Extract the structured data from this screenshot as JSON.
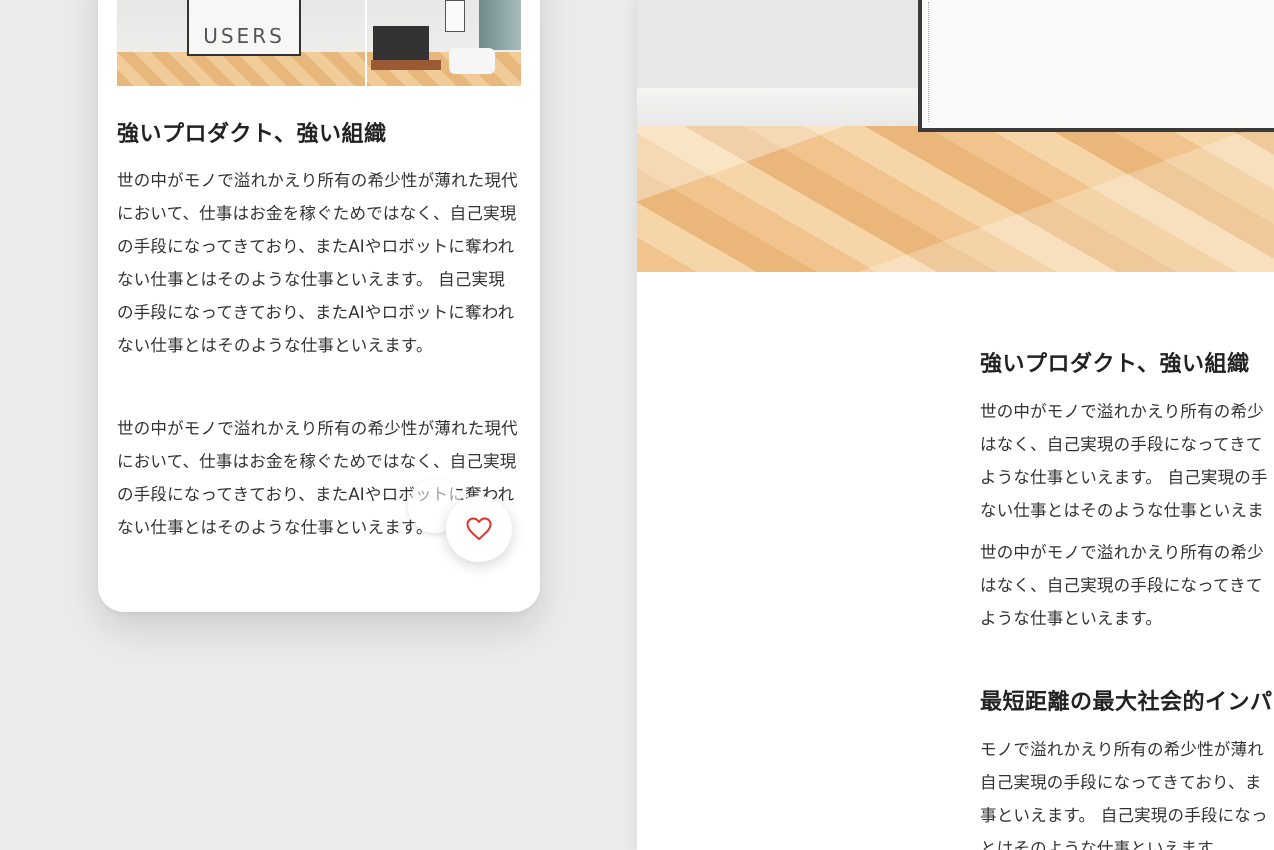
{
  "mobile_card": {
    "photo_poster_text": "USERS",
    "title": "強いプロダクト、強い組織",
    "paragraphs": [
      "世の中がモノで溢れかえり所有の希少性が薄れた現代において、仕事はお金を稼ぐためではなく、自己実現の手段になってきており、またAIやロボットに奪われない仕事とはそのような仕事といえます。 自己実現の手段になってきており、またAIやロボットに奪われない仕事とはそのような仕事といえます。",
      "世の中がモノで溢れかえり所有の希少性が薄れた現代において、仕事はお金を稼ぐためではなく、自己実現の手段になってきており、またAIやロボットに奪われない仕事とはそのような仕事といえます。"
    ],
    "favorite_icon": "heart-icon",
    "favorite_color": "#e0312b"
  },
  "desktop_panel": {
    "section1": {
      "title": "強いプロダクト、強い組織",
      "para1_lines": [
        "世の中がモノで溢れかえり所有の希少",
        "はなく、自己実現の手段になってきて",
        "ような仕事といえます。 自己実現の手",
        "ない仕事とはそのような仕事といえま"
      ],
      "para2_lines": [
        "世の中がモノで溢れかえり所有の希少",
        "はなく、自己実現の手段になってきて",
        "ような仕事といえます。"
      ]
    },
    "section2": {
      "title": "最短距離の最大社会的インパ",
      "para_lines": [
        "モノで溢れかえり所有の希少性が薄れ",
        "自己実現の手段になってきており、ま",
        "事といえます。 自己実現の手段になっ",
        "とはそのような仕事といえます。"
      ]
    }
  }
}
